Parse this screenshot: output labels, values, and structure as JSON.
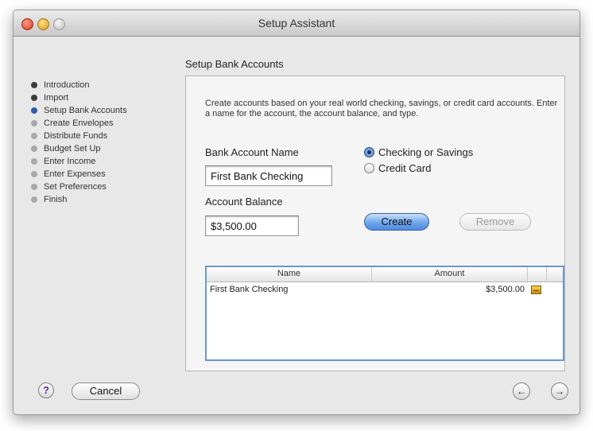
{
  "window": {
    "title": "Setup Assistant"
  },
  "steps": [
    {
      "label": "Introduction",
      "state": "done"
    },
    {
      "label": "Import",
      "state": "done"
    },
    {
      "label": "Setup Bank Accounts",
      "state": "current"
    },
    {
      "label": "Create Envelopes",
      "state": "pending"
    },
    {
      "label": "Distribute Funds",
      "state": "pending"
    },
    {
      "label": "Budget Set Up",
      "state": "pending"
    },
    {
      "label": "Enter Income",
      "state": "pending"
    },
    {
      "label": "Enter Expenses",
      "state": "pending"
    },
    {
      "label": "Set Preferences",
      "state": "pending"
    },
    {
      "label": "Finish",
      "state": "pending"
    }
  ],
  "section": {
    "title": "Setup Bank Accounts",
    "description": "Create accounts based on your real world checking, savings, or credit card accounts.  Enter a name for the account, the account balance, and type."
  },
  "form": {
    "name_label": "Bank Account Name",
    "name_value": "First Bank Checking",
    "balance_label": "Account Balance",
    "balance_value": "$3,500.00",
    "type_options": [
      "Checking or Savings",
      "Credit Card"
    ],
    "type_selected": "Checking or Savings",
    "create_label": "Create",
    "remove_label": "Remove"
  },
  "table": {
    "columns": [
      "Name",
      "Amount"
    ],
    "rows": [
      {
        "name": "First Bank Checking",
        "amount": "$3,500.00",
        "icon": "envelope-icon"
      }
    ]
  },
  "footer": {
    "help_label": "?",
    "cancel_label": "Cancel",
    "back_icon": "back-arrow-icon",
    "forward_icon": "forward-arrow-icon"
  },
  "colors": {
    "accent": "#4e8ae0",
    "current_step": "#2f5ea8",
    "focus_ring": "#6b96cf"
  }
}
